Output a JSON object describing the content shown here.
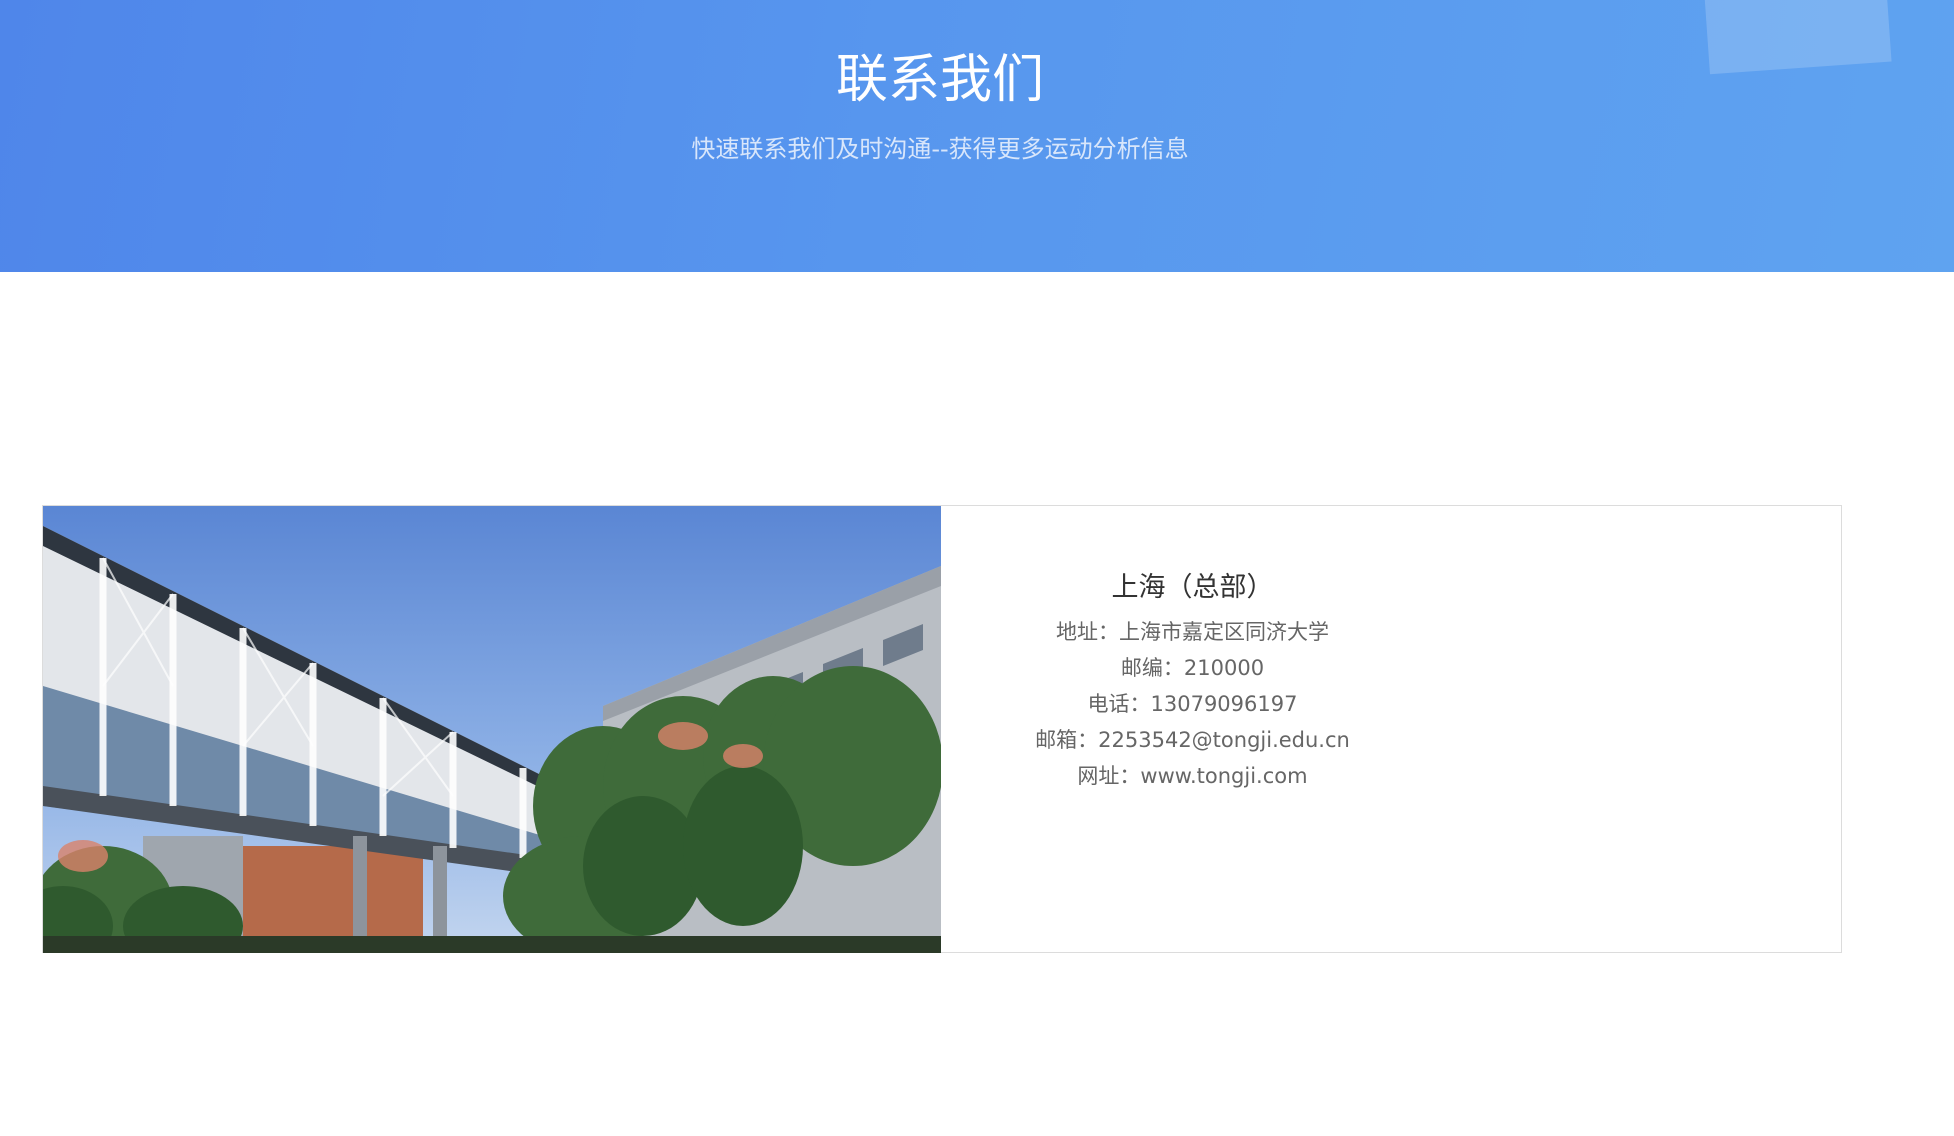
{
  "banner": {
    "title": "联系我们",
    "subtitle": "快速联系我们及时沟通--获得更多运动分析信息"
  },
  "office": {
    "title": "上海（总部）",
    "lines": [
      "地址：上海市嘉定区同济大学",
      "邮编：210000",
      "电话：13079096197",
      "邮箱：2253542@tongji.edu.cn",
      "网址：www.tongji.com"
    ]
  },
  "colors": {
    "banner_start": "#4f86ea",
    "banner_end": "#5fa3f0",
    "title_text": "#333333",
    "body_text": "#666666"
  }
}
